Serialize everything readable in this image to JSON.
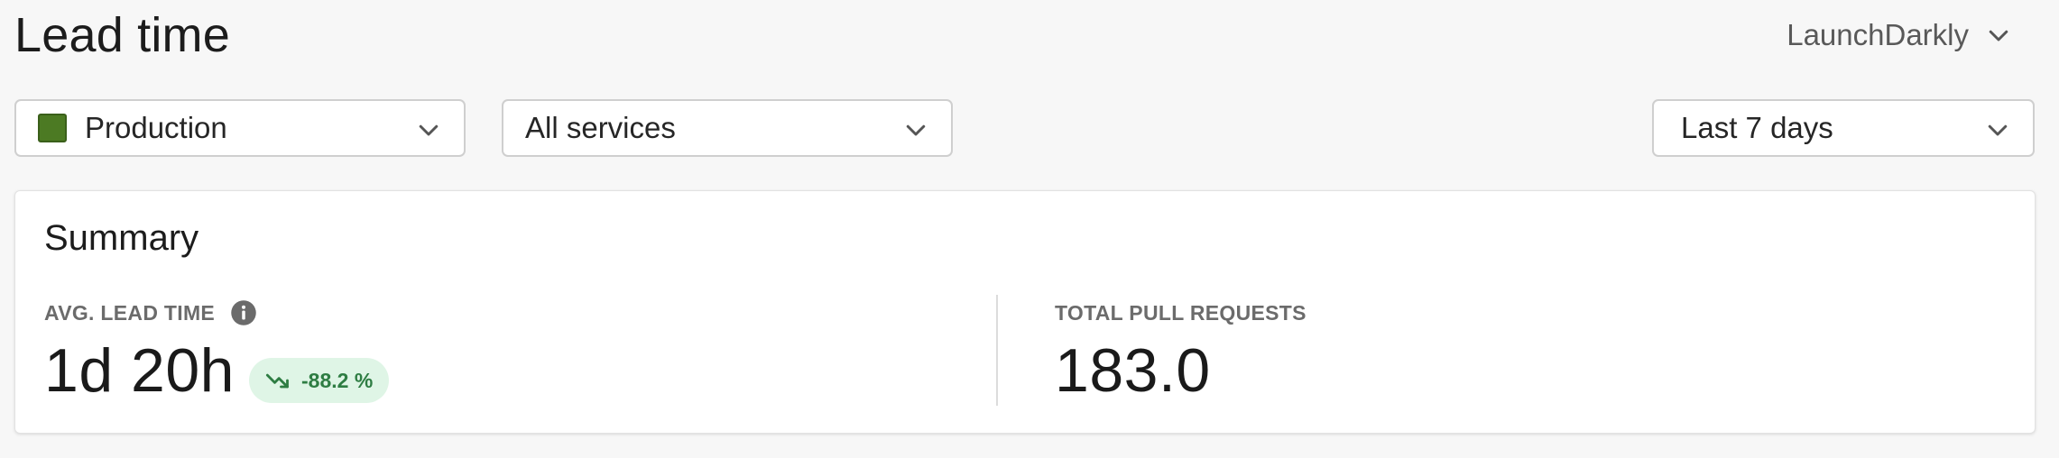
{
  "page": {
    "title": "Lead time"
  },
  "org_switcher": {
    "label": "LaunchDarkly",
    "icon": "chevron-down-icon"
  },
  "filters": {
    "environment": {
      "value": "Production",
      "swatch_color": "#4c7a23",
      "icon": "chevron-down-icon"
    },
    "service": {
      "value": "All services",
      "icon": "chevron-down-icon"
    },
    "date_range": {
      "value": "Last 7 days",
      "icon": "chevron-down-icon"
    }
  },
  "summary": {
    "title": "Summary",
    "avg_lead_time": {
      "label": "AVG. LEAD TIME",
      "value": "1d 20h",
      "trend": {
        "text": "-88.2 %",
        "direction": "down",
        "color": "#2e7d43",
        "background": "#dff5e6"
      },
      "info_icon": "info-icon"
    },
    "total_pull_requests": {
      "label": "TOTAL PULL REQUESTS",
      "value": "183.0"
    }
  }
}
